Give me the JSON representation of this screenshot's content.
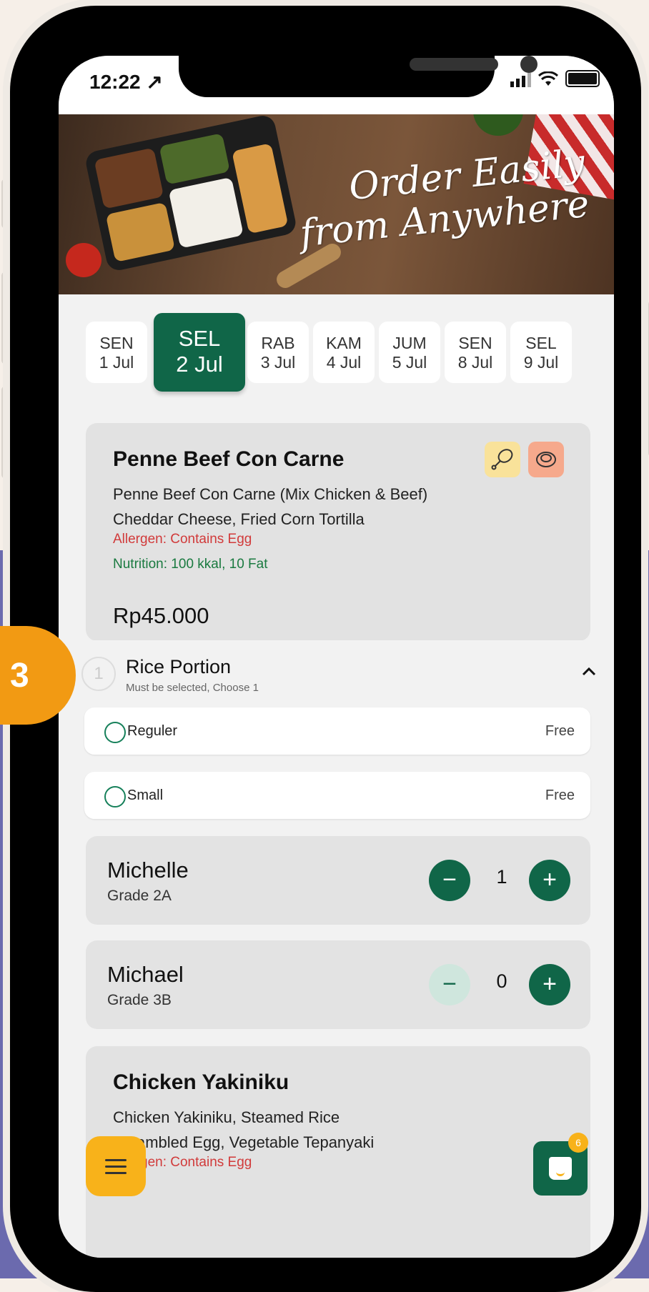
{
  "status_bar": {
    "time": "12:22 ↗"
  },
  "banner": {
    "line1": "Order Easily",
    "line2": "from Anywhere"
  },
  "dates": [
    {
      "day": "SEN",
      "date": "1 Jul",
      "active": false
    },
    {
      "day": "SEL",
      "date": "2 Jul",
      "active": true
    },
    {
      "day": "RAB",
      "date": "3 Jul",
      "active": false
    },
    {
      "day": "KAM",
      "date": "4 Jul",
      "active": false
    },
    {
      "day": "JUM",
      "date": "5 Jul",
      "active": false
    },
    {
      "day": "SEN",
      "date": "8 Jul",
      "active": false
    },
    {
      "day": "SEL",
      "date": "9 Jul",
      "active": false
    }
  ],
  "item": {
    "title": "Penne Beef Con Carne",
    "desc1": "Penne Beef Con Carne (Mix Chicken & Beef)",
    "desc2": "Cheddar Cheese, Fried Corn Tortilla",
    "allergen": "Allergen: Contains Egg",
    "nutrition": "Nutrition: 100 kkal, 10 Fat",
    "price": "Rp45.000",
    "icons": [
      "chicken-leg-icon",
      "meat-steak-icon"
    ]
  },
  "portion": {
    "step": "1",
    "title": "Rice Portion",
    "subtitle": "Must be selected, Choose 1",
    "options": [
      {
        "label": "Reguler",
        "price": "Free"
      },
      {
        "label": "Small",
        "price": "Free"
      }
    ]
  },
  "kids": [
    {
      "name": "Michelle",
      "grade": "Grade 2A",
      "qty": "1"
    },
    {
      "name": "Michael",
      "grade": "Grade 3B",
      "qty": "0"
    }
  ],
  "qty_controls": {
    "minus": "−",
    "plus": "+"
  },
  "item2": {
    "title": "Chicken Yakiniku",
    "desc1": "Chicken Yakiniku, Steamed Rice",
    "desc2": "Scrambled Egg, Vegetable Tepanyaki",
    "allergen": "Allergen: Contains Egg"
  },
  "cart": {
    "count": "6"
  },
  "step_badge": "3",
  "colors": {
    "primary": "#106648",
    "accent": "#f8b21a",
    "step": "#f29a13",
    "allergen": "#d13a3a",
    "nutrition": "#1a7a40"
  }
}
